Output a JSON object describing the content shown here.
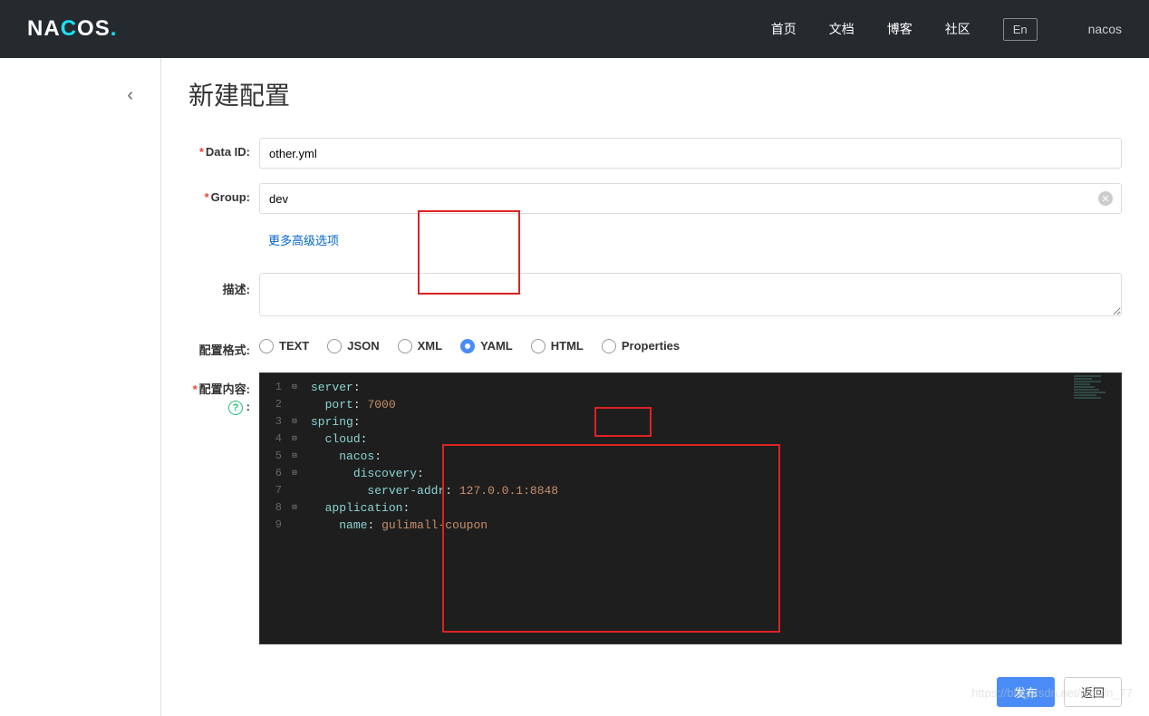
{
  "header": {
    "logo": "NACOS.",
    "nav": {
      "home": "首页",
      "docs": "文档",
      "blog": "博客",
      "community": "社区"
    },
    "lang": "En",
    "user": "nacos"
  },
  "sidebar": {
    "back": "‹"
  },
  "page": {
    "title": "新建配置"
  },
  "form": {
    "dataId": {
      "label": "Data ID:",
      "value": "other.yml"
    },
    "group": {
      "label": "Group:",
      "value": "dev"
    },
    "advanced": "更多高级选项",
    "desc": {
      "label": "描述:",
      "value": ""
    },
    "format": {
      "label": "配置格式:",
      "options": {
        "text": "TEXT",
        "json": "JSON",
        "xml": "XML",
        "yaml": "YAML",
        "html": "HTML",
        "properties": "Properties"
      },
      "selected": "yaml"
    },
    "content": {
      "label": "配置内容",
      "help": "?",
      "colon": ":",
      "value": "server:\n  port: 7000\nspring:\n  cloud:\n    nacos:\n      discovery:\n        server-addr: 127.0.0.1:8848\n  application:\n    name: gulimall-coupon"
    }
  },
  "actions": {
    "publish": "发布",
    "back": "返回"
  },
  "watermark": "https://blog.csdn.net/weixin_77"
}
